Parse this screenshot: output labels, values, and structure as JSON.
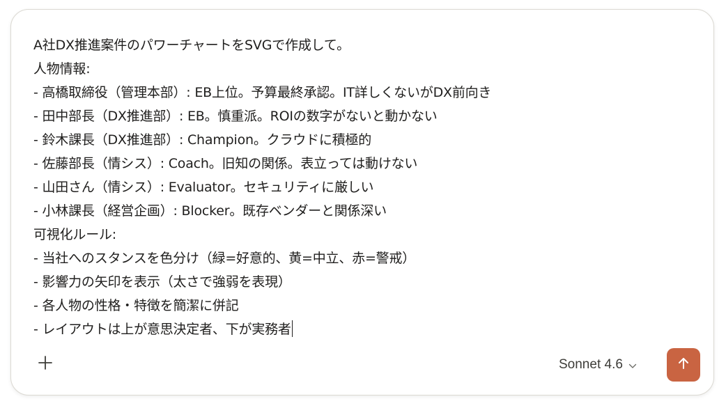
{
  "prompt": {
    "lines": [
      "A社DX推進案件のパワーチャートをSVGで作成して。",
      "人物情報:",
      "- 高橋取締役（管理本部）: EB上位。予算最終承認。IT詳しくないがDX前向き",
      "- 田中部長（DX推進部）: EB。慎重派。ROIの数字がないと動かない",
      "- 鈴木課長（DX推進部）: Champion。クラウドに積極的",
      "- 佐藤部長（情シス）: Coach。旧知の関係。表立っては動けない",
      "- 山田さん（情シス）: Evaluator。セキュリティに厳しい",
      "- 小林課長（経営企画）: Blocker。既存ベンダーと関係深い",
      "可視化ルール:",
      "- 当社へのスタンスを色分け（緑=好意的、黄=中立、赤=警戒）",
      "- 影響力の矢印を表示（太さで強弱を表現）",
      "- 各人物の性格・特徴を簡潔に併記",
      "- レイアウトは上が意思決定者、下が実務者"
    ]
  },
  "toolbar": {
    "model_label": "Sonnet 4.6",
    "add_icon": "plus-icon",
    "model_icon": "chevron-down-icon",
    "send_icon": "arrow-up-icon"
  },
  "colors": {
    "send_button": "#c96442",
    "text": "#1f1e1d",
    "border": "#dcdad3"
  }
}
